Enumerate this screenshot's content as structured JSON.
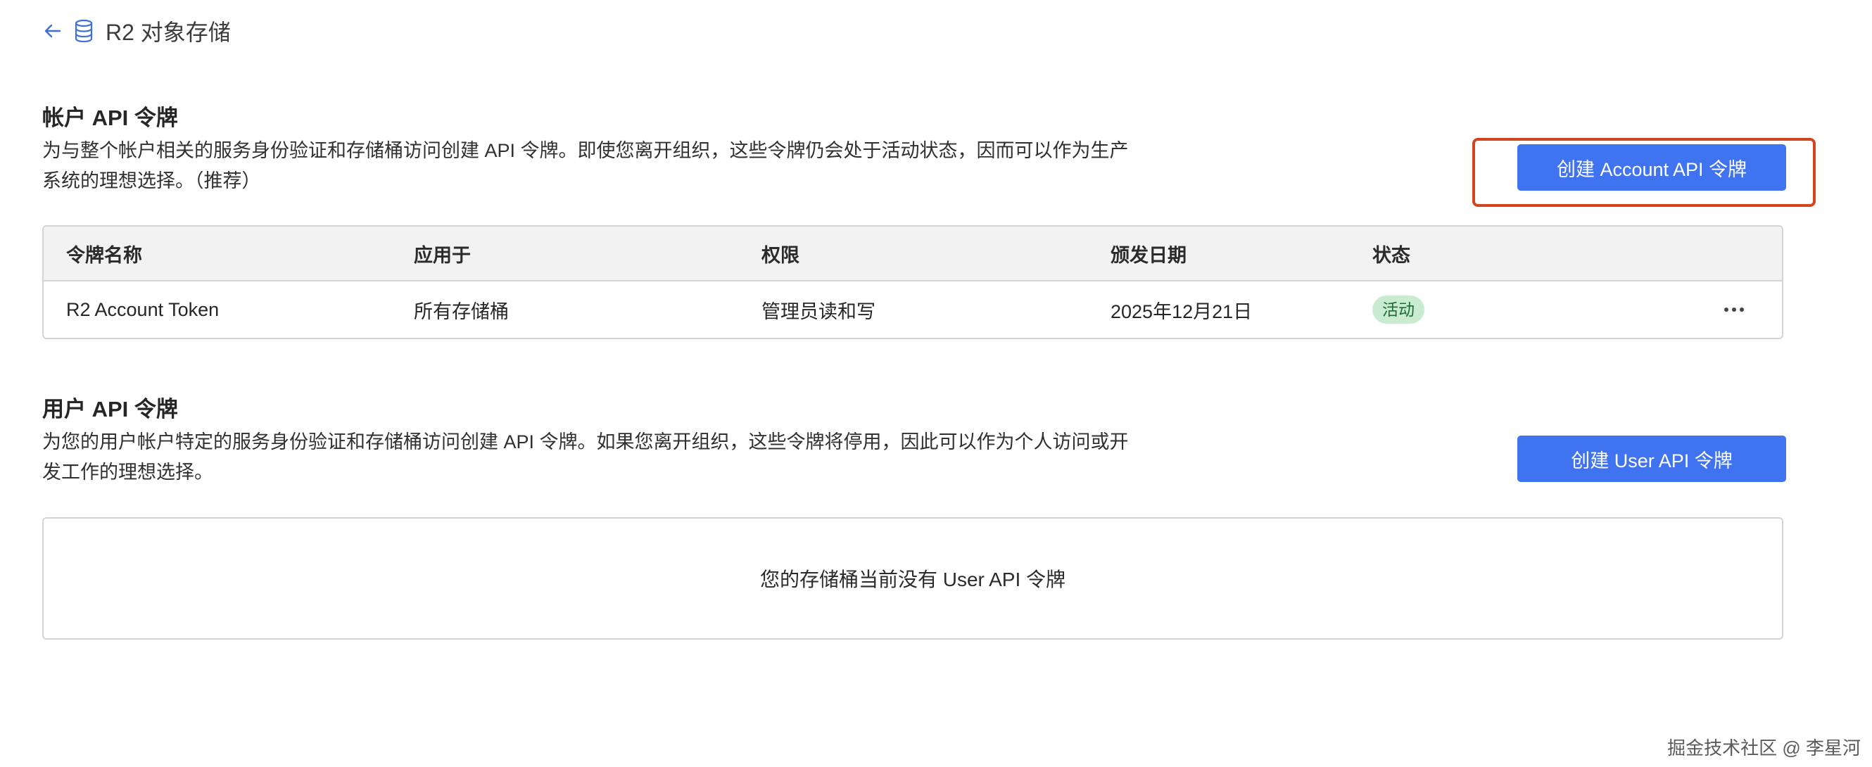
{
  "breadcrumb": {
    "back_icon": "arrow-left-icon",
    "service_icon": "database-icon",
    "label": "R2 对象存储"
  },
  "account_section": {
    "title": "帐户 API 令牌",
    "description_line1": "为与整个帐户相关的服务身份验证和存储桶访问创建 API 令牌。即使您离开组织，这些令牌仍会处于活动状态，因而可以作为生产",
    "description_line2": "系统的理想选择。（推荐）",
    "create_button": "创建 Account API 令牌",
    "highlight_color": "#d1451f"
  },
  "account_table": {
    "columns": [
      "令牌名称",
      "应用于",
      "权限",
      "颁发日期",
      "状态"
    ],
    "rows": [
      {
        "name": "R2 Account Token",
        "applies_to": "所有存储桶",
        "permission": "管理员读和写",
        "issued": "2025年12月21日",
        "status": "活动",
        "actions_icon": "more-horizontal-icon"
      }
    ]
  },
  "user_section": {
    "title": "用户 API 令牌",
    "description_line1": "为您的用户帐户特定的服务身份验证和存储桶访问创建 API 令牌。如果您离开组织，这些令牌将停用，因此可以作为个人访问或开",
    "description_line2": "发工作的理想选择。",
    "create_button": "创建 User API 令牌",
    "empty_message": "您的存储桶当前没有 User API 令牌"
  },
  "watermark": "掘金技术社区 @ 李星河",
  "colors": {
    "primary": "#3f73ef",
    "badge_bg": "#c9ecd1",
    "badge_text": "#1f6a37"
  }
}
